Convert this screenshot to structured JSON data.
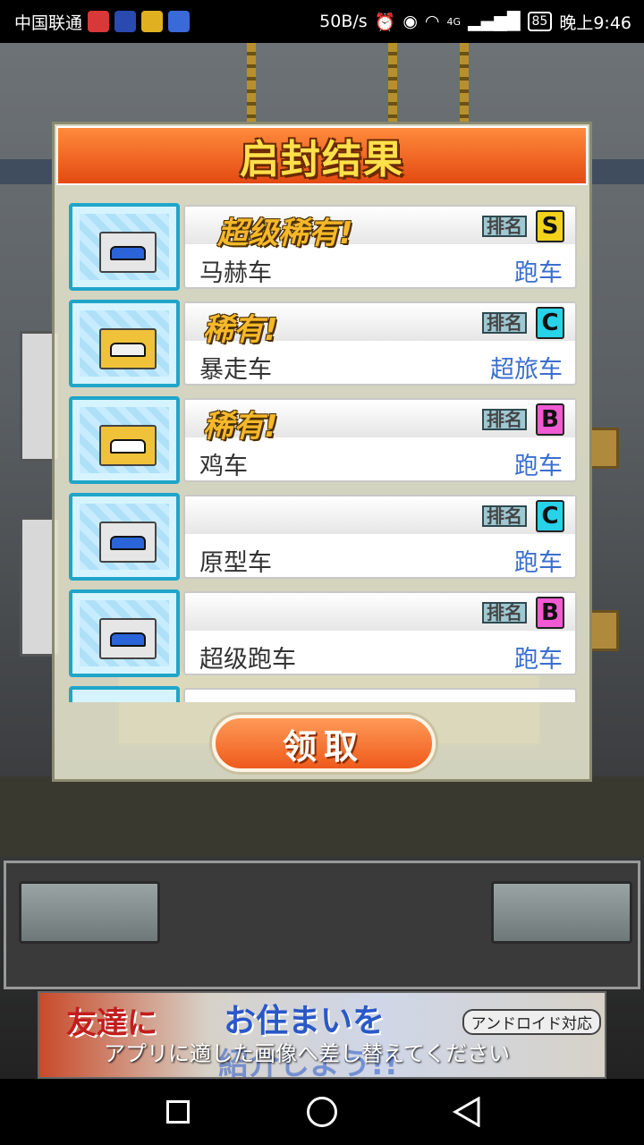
{
  "status_bar": {
    "carrier": "中国联通",
    "speed": "50B/s",
    "network": "4G",
    "battery": "85",
    "time": "晚上9:46"
  },
  "modal": {
    "title": "启封结果",
    "rank_label": "排名",
    "items": [
      {
        "rarity": "超级稀有!",
        "grade": "S",
        "grade_color": "#f2d21a",
        "name": "马赫车",
        "type": "跑车",
        "car_color": "#2a64d8",
        "box_color": "#e6e6e6"
      },
      {
        "rarity": "稀有!",
        "grade": "C",
        "grade_color": "#28d2e8",
        "name": "暴走车",
        "type": "超旅车",
        "car_color": "#f0f0f0",
        "box_color": "#f0c23a"
      },
      {
        "rarity": "稀有!",
        "grade": "B",
        "grade_color": "#f05ad2",
        "name": "鸡车",
        "type": "跑车",
        "car_color": "#ffffff",
        "box_color": "#f0c23a"
      },
      {
        "rarity": "",
        "grade": "C",
        "grade_color": "#28d2e8",
        "name": "原型车",
        "type": "跑车",
        "car_color": "#2a64d8",
        "box_color": "#e6e6e6"
      },
      {
        "rarity": "",
        "grade": "B",
        "grade_color": "#f05ad2",
        "name": "超级跑车",
        "type": "跑车",
        "car_color": "#2a64d8",
        "box_color": "#e6e6e6"
      }
    ],
    "claim_button": "领取"
  },
  "ad": {
    "line1": "友達に",
    "line2": "お住まいを",
    "line3": "紹介しよう!!",
    "badge": "アンドロイド対応",
    "overlay": "アプリに適した画像へ差し替えてください"
  }
}
